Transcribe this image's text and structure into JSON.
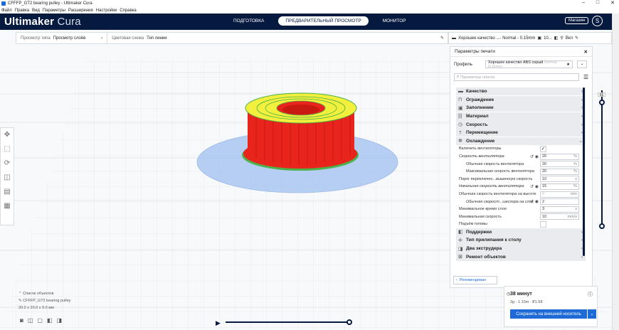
{
  "window": {
    "title": "CFFFP_GT2 bearing pulley - Ultimaker Cura",
    "minimize": "–",
    "maximize": "□",
    "close": "✕"
  },
  "menu": [
    "Файл",
    "Правка",
    "Вид",
    "Параметры",
    "Расширения",
    "Настройки",
    "Справка"
  ],
  "header": {
    "logo_bold": "Ultimaker",
    "logo_light": " Cura",
    "stages": [
      "ПОДГОТОВКА",
      "ПРЕДВАРИТЕЛЬНЫЙ ПРОСМОТР",
      "МОНИТОР"
    ],
    "active_stage": 1,
    "marketplace": "Магазин",
    "avatar": "S"
  },
  "view_toolbar": {
    "view_type_label": "Просмотр типа",
    "view_type_value": "Просмотр слоёв",
    "color_scheme_label": "Цветовая схема",
    "color_scheme_value": "Тип линии"
  },
  "print_setup": {
    "quality": "Хорошее качество ...- Normal - 0.15mm",
    "infill": "10...",
    "adhesion": "Вкл"
  },
  "panel": {
    "title": "Параметры печати",
    "profile_label": "Профиль",
    "profile_value": "Хорошее качество ABS серый",
    "profile_hint": "Normal - 0.15mm",
    "search_placeholder": "Параметры поиска",
    "categories_top": [
      {
        "icon": "quality-icon",
        "label": "Качество"
      },
      {
        "icon": "shell-icon",
        "label": "Ограждение"
      },
      {
        "icon": "infill-icon",
        "label": "Заполнение"
      },
      {
        "icon": "material-icon",
        "label": "Материал"
      },
      {
        "icon": "speed-icon",
        "label": "Скорость"
      },
      {
        "icon": "travel-icon",
        "label": "Перемещение"
      },
      {
        "icon": "cooling-icon",
        "label": "Охлаждение"
      }
    ],
    "cooling_settings": [
      {
        "label": "Включить вентиляторы",
        "type": "check",
        "value": "✓"
      },
      {
        "label": "Скорость вентилятора",
        "type": "value",
        "value": "20",
        "unit": "%",
        "italic": true,
        "reset": true
      },
      {
        "label": "Обычная скорость вентилятора",
        "type": "value",
        "value": "20",
        "unit": "%",
        "indent": true
      },
      {
        "label": "Максимальная скорость вентилятора",
        "type": "value",
        "value": "20",
        "unit": "%",
        "indent": true
      },
      {
        "label": "Порог переключен...вышенную скорость",
        "type": "value",
        "value": "10",
        "unit": "s"
      },
      {
        "label": "Начальная скорость вентилятора",
        "type": "value",
        "value": "15",
        "unit": "%",
        "italic": true,
        "reset": true
      },
      {
        "label": "Обычная скорость вентилятора на высоте",
        "type": "value",
        "value": "0",
        "unit": "mm",
        "disabled": true
      },
      {
        "label": "Обычная скорост...шеспора на слое",
        "type": "value",
        "value": "2",
        "unit": "",
        "indent": true,
        "italic": true,
        "reset": true
      },
      {
        "label": "Минимальное время слоя",
        "type": "value",
        "value": "3",
        "unit": "s"
      },
      {
        "label": "Минимальная скорость",
        "type": "value",
        "value": "10",
        "unit": "mm/s"
      },
      {
        "label": "Подъём головы",
        "type": "check",
        "value": ""
      }
    ],
    "categories_bottom": [
      {
        "icon": "support-icon",
        "label": "Поддержки"
      },
      {
        "icon": "adhesion-icon",
        "label": "Тип прилипания к столу"
      },
      {
        "icon": "dual-extruder-icon",
        "label": "Два экструдера"
      },
      {
        "icon": "mesh-fix-icon",
        "label": "Ремонт объектов"
      }
    ],
    "recommended_button": "Рекомендован"
  },
  "layer_slider": {
    "max_layer": "66"
  },
  "object_list": {
    "title": "Список объектов",
    "name": "CFFFP_GT2 bearing pulley",
    "dims": "20.0 x 20.0 x 9.0 мм"
  },
  "estimate": {
    "time": "38 минут",
    "material": "3g · 1.10m · ₽1.58",
    "save_button": "Сохранить на внешний носитель"
  },
  "colors": {
    "header_bg": "#061a40",
    "accent": "#1e6bd8",
    "model_red": "#e8241c",
    "model_yellow": "#f2f03c",
    "model_green": "#4cb24a",
    "buildplate_blue": "#9fc0ef"
  }
}
